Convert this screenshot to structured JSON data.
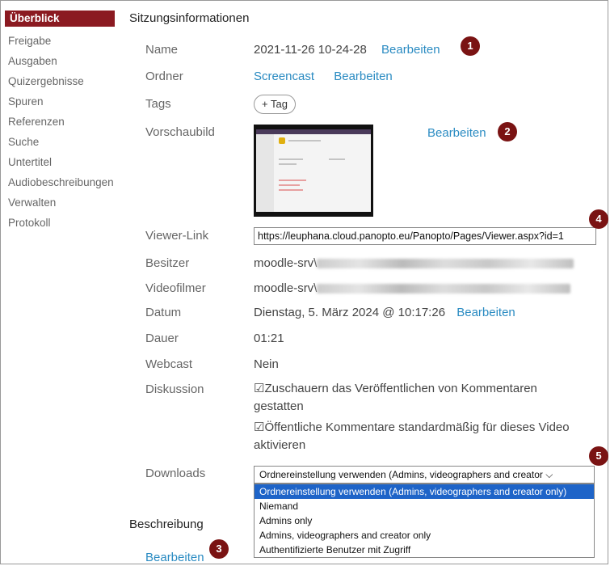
{
  "sidebar": {
    "items": [
      "Überblick",
      "Freigabe",
      "Ausgaben",
      "Quizergebnisse",
      "Spuren",
      "Referenzen",
      "Suche",
      "Untertitel",
      "Audiobeschreibungen",
      "Verwalten",
      "Protokoll"
    ]
  },
  "section_title": "Sitzungsinformationen",
  "edit_label": "Bearbeiten",
  "fields": {
    "name_label": "Name",
    "name_value": "2021-11-26 10-24-28",
    "folder_label": "Ordner",
    "folder_value": "Screencast",
    "tags_label": "Tags",
    "tag_button": "+ Tag",
    "thumb_label": "Vorschaubild",
    "viewer_label": "Viewer-Link",
    "viewer_value": "https://leuphana.cloud.panopto.eu/Panopto/Pages/Viewer.aspx?id=1",
    "owner_label": "Besitzer",
    "owner_value": "moodle-srv\\",
    "videographer_label": "Videofilmer",
    "videographer_value": "moodle-srv\\",
    "date_label": "Datum",
    "date_value": "Dienstag, 5. März 2024 @ 10:17:26",
    "duration_label": "Dauer",
    "duration_value": "01:21",
    "webcast_label": "Webcast",
    "webcast_value": "Nein",
    "discussion_label": "Diskussion",
    "discussion_opt1": "☑Zuschauern das Veröffentlichen von Kommentaren gestatten",
    "discussion_opt2": "☑Öffentliche Kommentare standardmäßig für dieses Video aktivieren",
    "downloads_label": "Downloads",
    "downloads_selected": "Ordnereinstellung verwenden (Admins, videographers and creator ⌵",
    "downloads_options": [
      "Ordnereinstellung verwenden (Admins, videographers and creator only)",
      "Niemand",
      "Admins only",
      "Admins, videographers and creator only",
      "Authentifizierte Benutzer mit Zugriff"
    ],
    "description_label": "Beschreibung"
  },
  "badges": [
    "1",
    "2",
    "3",
    "4",
    "5"
  ],
  "colors": {
    "accent": "#8b1a21",
    "link": "#2a8bc2",
    "badge": "#7a1313",
    "selected_option": "#1e64c8"
  }
}
